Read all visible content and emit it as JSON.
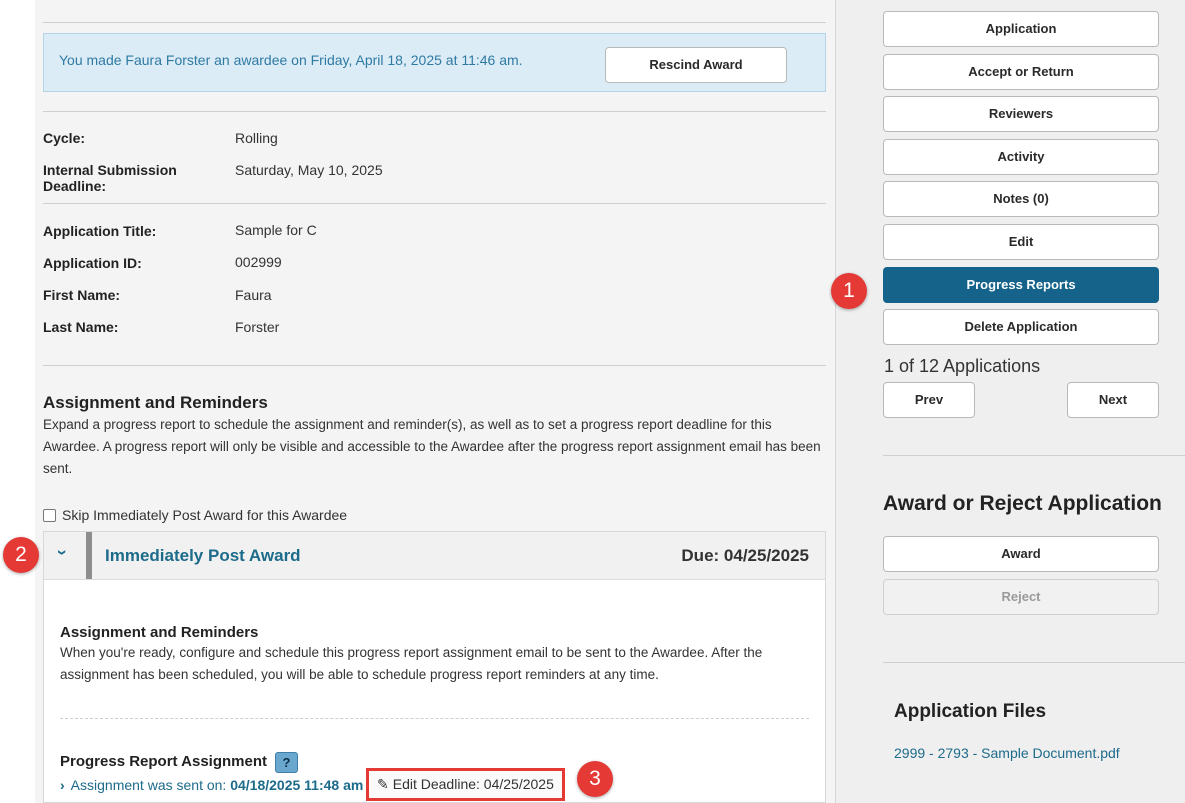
{
  "banner": {
    "message": "You made Faura Forster an awardee on Friday, April 18, 2025 at 11:46 am.",
    "rescind_label": "Rescind Award"
  },
  "cycle_info": {
    "cycle_label": "Cycle:",
    "cycle_value": "Rolling",
    "deadline_label": "Internal Submission Deadline:",
    "deadline_value": "Saturday, May 10, 2025"
  },
  "application": {
    "title_label": "Application Title:",
    "title_value": "Sample for C",
    "id_label": "Application ID:",
    "id_value": "002999",
    "first_name_label": "First Name:",
    "first_name_value": "Faura",
    "last_name_label": "Last Name:",
    "last_name_value": "Forster"
  },
  "assignment": {
    "heading": "Assignment and Reminders",
    "description": "Expand a progress report to schedule the assignment and reminder(s), as well as to set a progress report deadline for this Awardee. A progress report will only be visible and accessible to the Awardee after the progress report assignment email has been sent.",
    "skip_label": "Skip Immediately Post Award for this Awardee",
    "skip_checked": false
  },
  "panel": {
    "title": "Immediately Post Award",
    "due": "Due: 04/25/2025",
    "chevron_icon": "chevron-down-icon",
    "inner_heading": "Assignment and Reminders",
    "inner_text": "When you're ready, configure and schedule this progress report assignment email to be sent to the Awardee. After the assignment has been scheduled, you will be able to schedule progress report reminders at any time.",
    "report_heading": "Progress Report Assignment",
    "help_symbol": "?",
    "sent_label": "Assignment was sent on:",
    "sent_date": "04/18/2025 11:48 am",
    "edit_deadline": "Edit Deadline: 04/25/2025",
    "edit_icon": "pencil-icon"
  },
  "sidebar": {
    "buttons": [
      {
        "label": "Application",
        "active": false
      },
      {
        "label": "Accept or Return",
        "active": false
      },
      {
        "label": "Reviewers",
        "active": false
      },
      {
        "label": "Activity",
        "active": false
      },
      {
        "label": "Notes (0)",
        "active": false
      },
      {
        "label": "Edit",
        "active": false
      },
      {
        "label": "Progress Reports",
        "active": true
      },
      {
        "label": "Delete Application",
        "active": false
      }
    ],
    "count_text": "1 of 12 Applications",
    "prev_label": "Prev",
    "next_label": "Next",
    "award_heading": "Award or Reject Application",
    "award_label": "Award",
    "reject_label": "Reject",
    "files_heading": "Application Files",
    "file_name": "2999 - 2793 - Sample Document.pdf"
  },
  "markers": [
    "1",
    "2",
    "3"
  ],
  "colors": {
    "accent": "#15638a",
    "link": "#1d6b8a",
    "banner_bg": "#dcecf6",
    "marker_red": "#e53935"
  }
}
